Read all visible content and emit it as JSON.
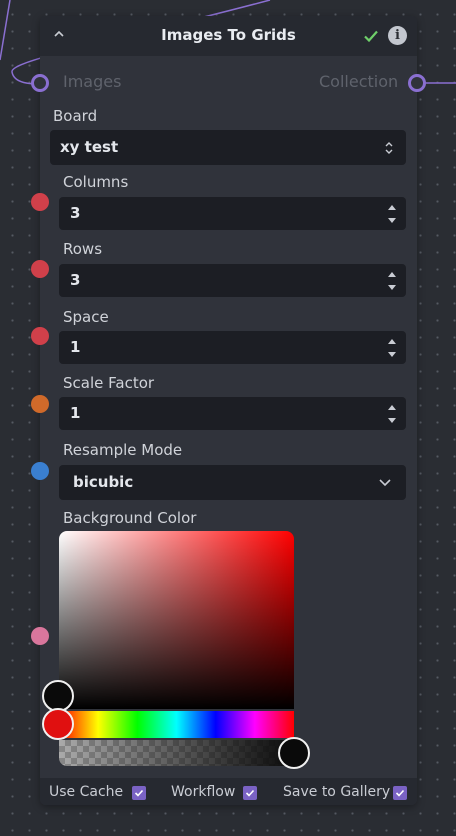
{
  "node": {
    "title": "Images To Grids",
    "icons": {
      "collapse": "chevron-up-icon",
      "status": "check-icon",
      "info": "info-icon"
    },
    "info_glyph": "i"
  },
  "io": {
    "input_label": "Images",
    "output_label": "Collection"
  },
  "fields": {
    "board": {
      "label": "Board",
      "value": "xy test"
    },
    "columns": {
      "label": "Columns",
      "value": "3"
    },
    "rows": {
      "label": "Rows",
      "value": "3"
    },
    "space": {
      "label": "Space",
      "value": "1"
    },
    "scale_factor": {
      "label": "Scale Factor",
      "value": "1"
    },
    "resample_mode": {
      "label": "Resample Mode",
      "value": "bicubic"
    },
    "background_color": {
      "label": "Background Color",
      "selected_color": "#0a0a0a",
      "hue": "#ff0000",
      "alpha": 1.0
    }
  },
  "handle_colors": {
    "connection": "#8a6fd1",
    "columns": "#d0404a",
    "rows": "#d0404a",
    "space": "#d0404a",
    "scale_factor": "#d06a2a",
    "resample_mode": "#3a7fd0",
    "background_color": "#d9769c"
  },
  "footer": {
    "use_cache": {
      "label": "Use Cache",
      "checked": true
    },
    "workflow": {
      "label": "Workflow",
      "checked": true
    },
    "save_to_gallery": {
      "label": "Save to Gallery",
      "checked": true
    }
  },
  "colors": {
    "accent": "#7a62c4",
    "node_bg": "#30333b",
    "canvas_bg": "#2a2d33"
  }
}
